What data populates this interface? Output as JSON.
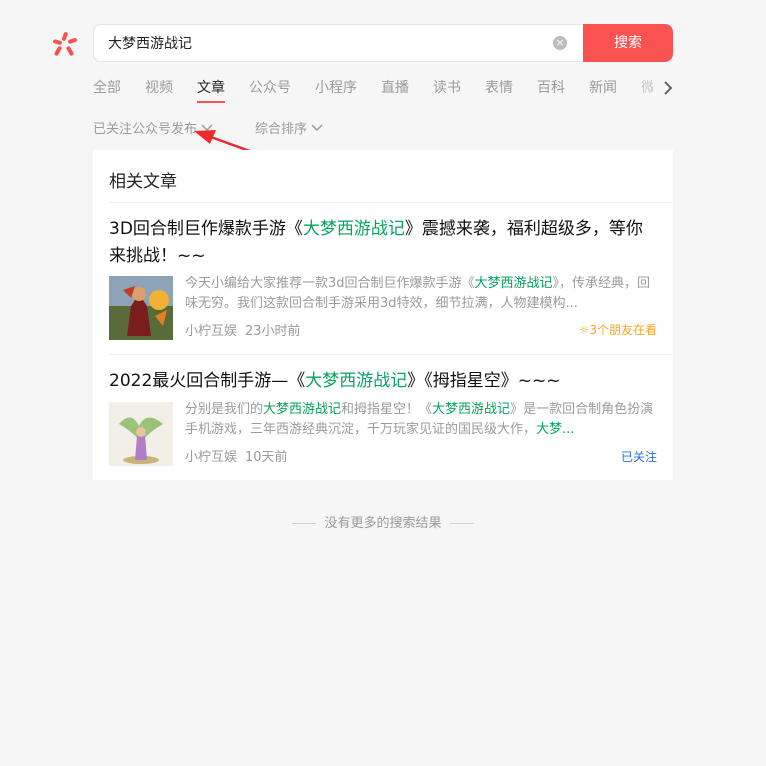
{
  "search": {
    "query": "大梦西游战记",
    "button_label": "搜索",
    "clear_icon": "clear-icon"
  },
  "tabs": [
    {
      "label": "全部"
    },
    {
      "label": "视频"
    },
    {
      "label": "文章",
      "active": true
    },
    {
      "label": "公众号"
    },
    {
      "label": "小程序"
    },
    {
      "label": "直播"
    },
    {
      "label": "读书"
    },
    {
      "label": "表情"
    },
    {
      "label": "百科"
    },
    {
      "label": "新闻"
    },
    {
      "label": "微"
    }
  ],
  "filters": {
    "followed_publish": "已关注公众号发布",
    "sort": "综合排序"
  },
  "section": {
    "title": "相关文章"
  },
  "results": [
    {
      "title_before": "3D回合制巨作爆款手游《",
      "title_highlight": "大梦西游战记",
      "title_after": "》震撼来袭，福利超级多，等你来挑战！~~",
      "snippet_before": "今天小编给大家推荐一款3d回合制巨作爆款手游《",
      "snippet_highlight": "大梦西游战记",
      "snippet_after": "》，传承经典，回味无穷。我们这款回合制手游采用3d特效，细节拉满，人物建模构...",
      "author": "小柠互娱",
      "time": "23小时前",
      "badge": "3个朋友在看"
    },
    {
      "title_before": "2022最火回合制手游—《",
      "title_highlight": "大梦西游战记",
      "title_after": "》《拇指星空》~~~",
      "snippet_p1": "分别是我们的",
      "snippet_h1": "大梦西游战记",
      "snippet_p2": "和拇指星空！《",
      "snippet_h2": "大梦西游战记",
      "snippet_p3": "》是一款回合制角色扮演手机游戏，三年西游经典沉淀，千万玩家见证的国民级大作，",
      "snippet_h3": "大梦...",
      "author": "小柠互娱",
      "time": "10天前",
      "badge": "已关注"
    }
  ],
  "footer": {
    "no_more": "没有更多的搜索结果"
  },
  "colors": {
    "accent": "#fa5151",
    "highlight": "#07a35c",
    "followed": "#2a71d9",
    "friends": "#f5a623"
  }
}
